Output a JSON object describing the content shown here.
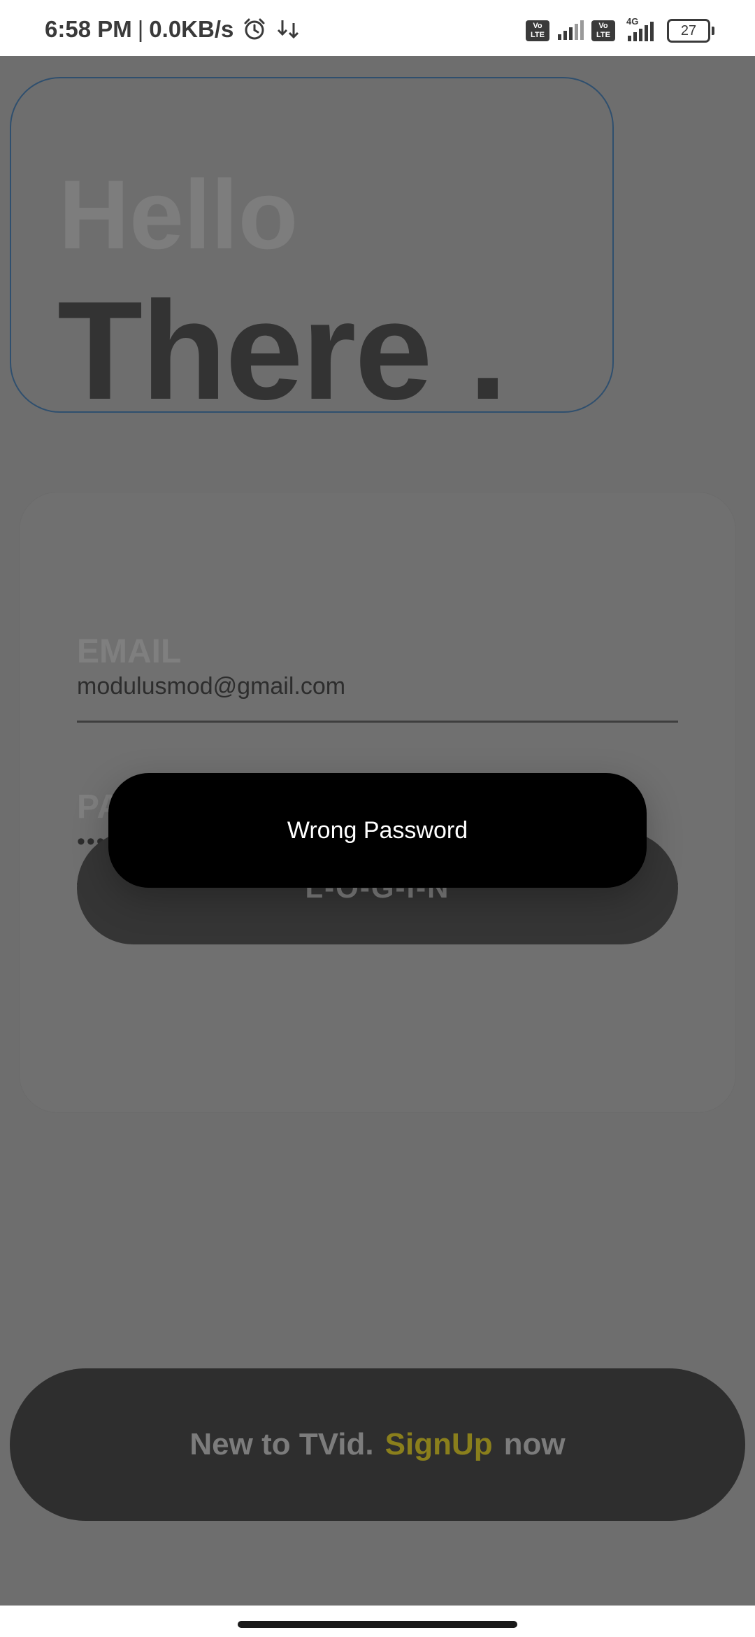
{
  "status_bar": {
    "time": "6:58 PM",
    "separator": "|",
    "net_speed": "0.0KB/s",
    "volte1": "Vo LTE",
    "volte2": "Vo LTE",
    "network_type": "4G",
    "battery": "27",
    "icons": [
      "alarm-icon",
      "download-icon",
      "signal-icon",
      "battery-icon"
    ]
  },
  "hero": {
    "hello": "Hello",
    "there": "There ."
  },
  "login_form": {
    "email_label": "EMAIL",
    "email_value": "modulusmod@gmail.com",
    "password_label": "PASSWORD",
    "password_value": "••••",
    "login_button": "L-O-G-I-N"
  },
  "signup": {
    "prefix": "New to TVid.",
    "link": "SignUp",
    "suffix": "now"
  },
  "toast": {
    "message": "Wrong Password"
  },
  "colors": {
    "overlay_bg": "#6e6e6e",
    "accent": "#8a7f1c",
    "toast_bg": "#000000"
  }
}
